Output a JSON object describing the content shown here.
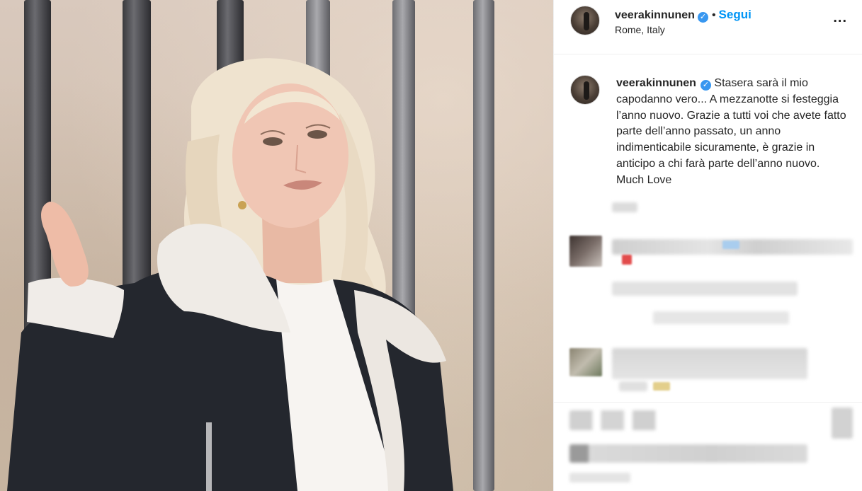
{
  "post": {
    "username": "veerakinnunen",
    "verified": true,
    "follow_label": "Segui",
    "separator": "•",
    "location": "Rome, Italy",
    "more_icon": "more-horizontal-icon",
    "more_label": "...",
    "caption": "Stasera sarà il mio capodanno vero... A mezzanotte si festeggia l’anno nuovo. Grazie a tutti voi che avete fatto parte dell’anno passato, un anno indimenticabile sicuramente, è grazie in anticipo a chi farà parte dell’anno nuovo. Much Love"
  },
  "colors": {
    "accent": "#0095f6",
    "verified": "#3897f0",
    "text": "#262626"
  }
}
